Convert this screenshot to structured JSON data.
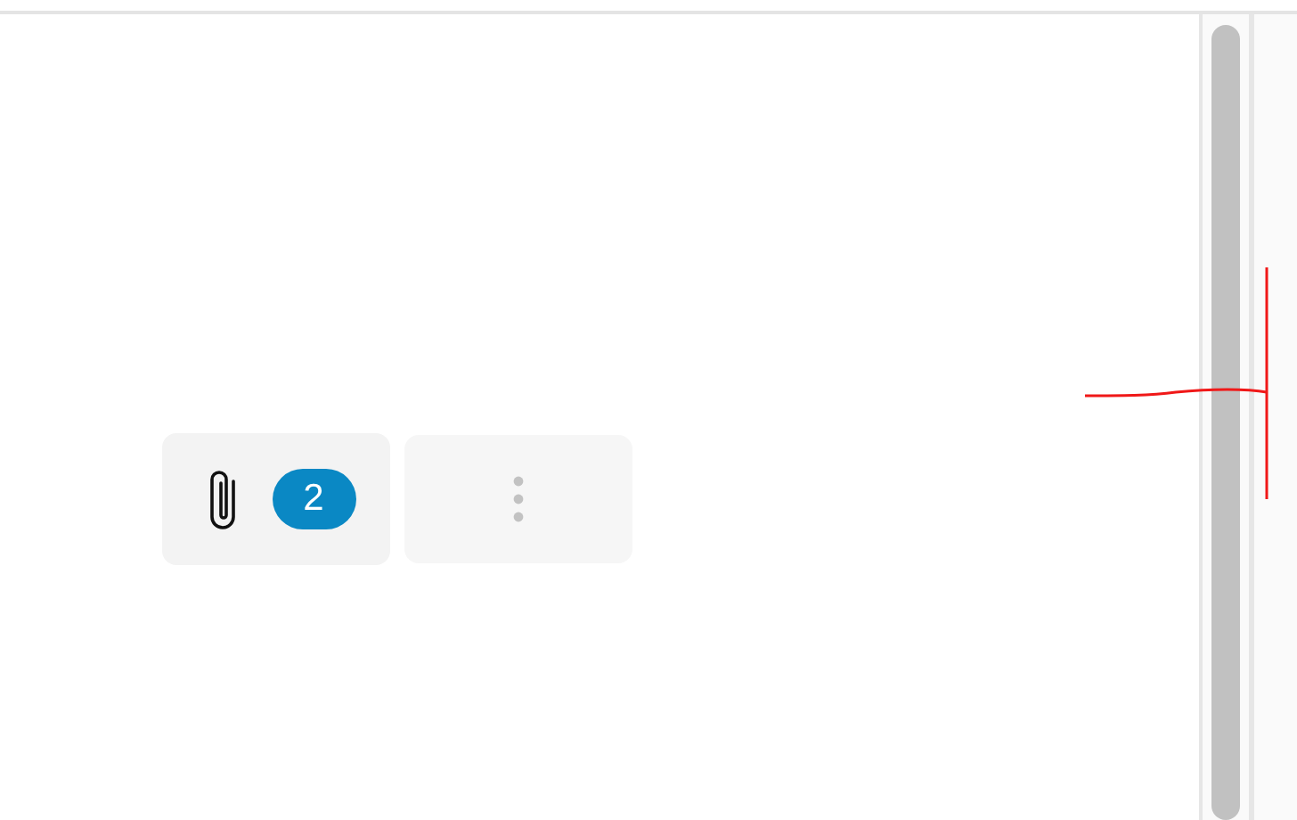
{
  "toolbar": [
    {
      "kind": "attachments",
      "badge": "2"
    },
    {
      "kind": "more"
    }
  ]
}
